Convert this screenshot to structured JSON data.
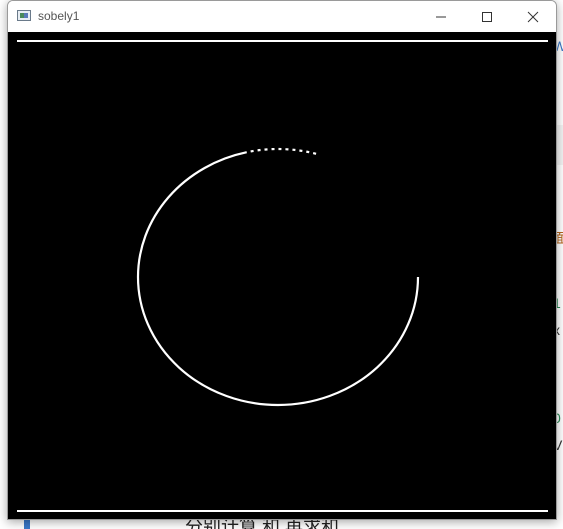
{
  "window": {
    "title": "sobely1",
    "controls": {
      "minimize_icon": "minimize-icon",
      "maximize_icon": "maximize-icon",
      "close_icon": "close-icon"
    }
  },
  "image": {
    "background_color": "#000000",
    "stroke_color": "#ffffff",
    "content": "sobel-y edge image of a circle with top and bottom horizontal edge lines"
  },
  "background": {
    "side_glyphs": [
      "W",
      "面",
      "1",
      "x",
      "0",
      "V"
    ],
    "bottom_text": "分别计算 和    再求和",
    "accent_color": "#3a78c9",
    "green_color": "#2e8b57"
  }
}
